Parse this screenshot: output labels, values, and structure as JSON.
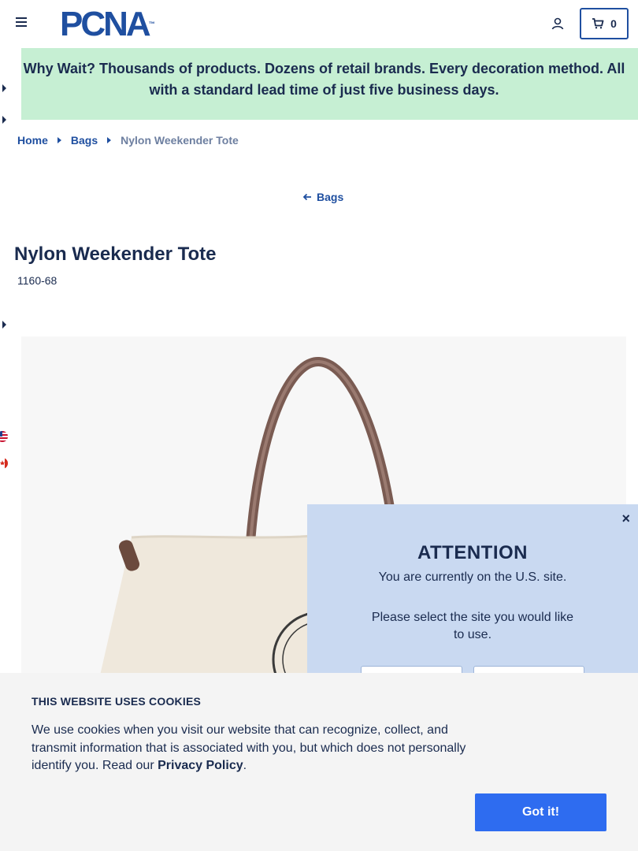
{
  "header": {
    "logo_text": "PCNA",
    "logo_mark": "™",
    "cart_count": "0"
  },
  "banner": {
    "line1": "Why Wait? Thousands of products. Dozens of retail brands. Every decoration method. All",
    "line2": "with a standard lead time of just five business days."
  },
  "breadcrumb": {
    "home": "Home",
    "bags": "Bags",
    "current": "Nylon Weekender Tote"
  },
  "back_link": "Bags",
  "product": {
    "title": "Nylon Weekender Tote",
    "sku": "1160-68"
  },
  "attention_modal": {
    "title": "ATTENTION",
    "message": "You are currently on the U.S. site.",
    "prompt": "Please select the site you would like to use.",
    "close": "×"
  },
  "cookie_banner": {
    "title": "THIS WEBSITE USES COOKIES",
    "text": "We use cookies when you visit our website that can recognize, collect, and transmit information that is associated with you, but which does not personally identify you. Read our ",
    "policy_link": "Privacy Policy",
    "period": ".",
    "button": "Got it!"
  },
  "colors": {
    "brand_blue": "#1f4fa0",
    "banner_green": "#c6efd3",
    "modal_blue": "#c9d9f1",
    "button_blue": "#2e6cf0"
  }
}
